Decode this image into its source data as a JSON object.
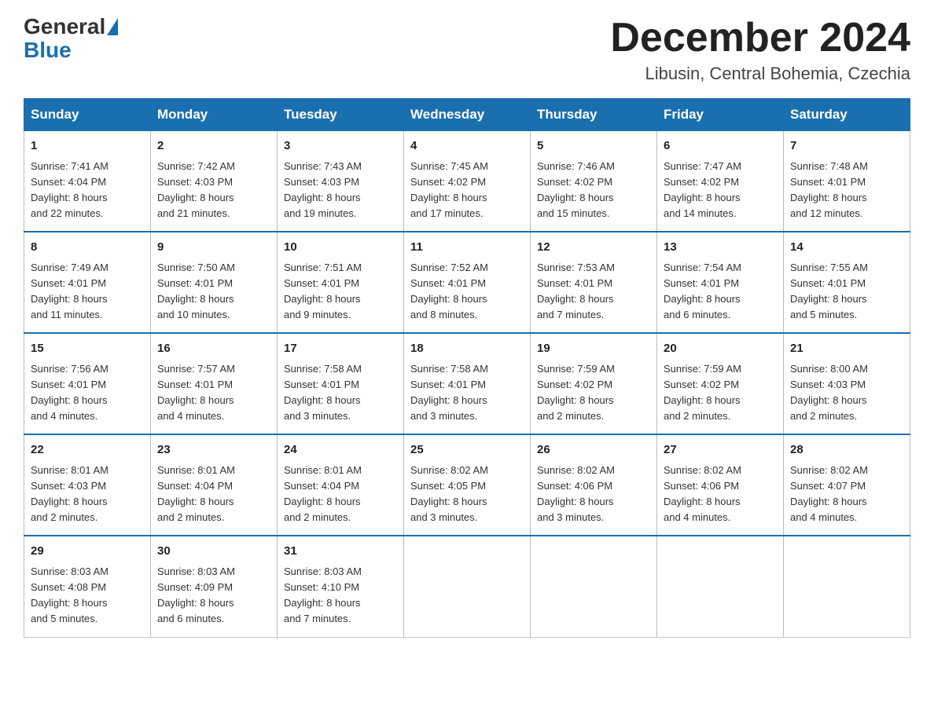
{
  "header": {
    "logo_general": "General",
    "logo_blue": "Blue",
    "title": "December 2024",
    "subtitle": "Libusin, Central Bohemia, Czechia"
  },
  "days_of_week": [
    "Sunday",
    "Monday",
    "Tuesday",
    "Wednesday",
    "Thursday",
    "Friday",
    "Saturday"
  ],
  "weeks": [
    [
      {
        "day": "1",
        "sunrise": "7:41 AM",
        "sunset": "4:04 PM",
        "daylight": "8 hours and 22 minutes."
      },
      {
        "day": "2",
        "sunrise": "7:42 AM",
        "sunset": "4:03 PM",
        "daylight": "8 hours and 21 minutes."
      },
      {
        "day": "3",
        "sunrise": "7:43 AM",
        "sunset": "4:03 PM",
        "daylight": "8 hours and 19 minutes."
      },
      {
        "day": "4",
        "sunrise": "7:45 AM",
        "sunset": "4:02 PM",
        "daylight": "8 hours and 17 minutes."
      },
      {
        "day": "5",
        "sunrise": "7:46 AM",
        "sunset": "4:02 PM",
        "daylight": "8 hours and 15 minutes."
      },
      {
        "day": "6",
        "sunrise": "7:47 AM",
        "sunset": "4:02 PM",
        "daylight": "8 hours and 14 minutes."
      },
      {
        "day": "7",
        "sunrise": "7:48 AM",
        "sunset": "4:01 PM",
        "daylight": "8 hours and 12 minutes."
      }
    ],
    [
      {
        "day": "8",
        "sunrise": "7:49 AM",
        "sunset": "4:01 PM",
        "daylight": "8 hours and 11 minutes."
      },
      {
        "day": "9",
        "sunrise": "7:50 AM",
        "sunset": "4:01 PM",
        "daylight": "8 hours and 10 minutes."
      },
      {
        "day": "10",
        "sunrise": "7:51 AM",
        "sunset": "4:01 PM",
        "daylight": "8 hours and 9 minutes."
      },
      {
        "day": "11",
        "sunrise": "7:52 AM",
        "sunset": "4:01 PM",
        "daylight": "8 hours and 8 minutes."
      },
      {
        "day": "12",
        "sunrise": "7:53 AM",
        "sunset": "4:01 PM",
        "daylight": "8 hours and 7 minutes."
      },
      {
        "day": "13",
        "sunrise": "7:54 AM",
        "sunset": "4:01 PM",
        "daylight": "8 hours and 6 minutes."
      },
      {
        "day": "14",
        "sunrise": "7:55 AM",
        "sunset": "4:01 PM",
        "daylight": "8 hours and 5 minutes."
      }
    ],
    [
      {
        "day": "15",
        "sunrise": "7:56 AM",
        "sunset": "4:01 PM",
        "daylight": "8 hours and 4 minutes."
      },
      {
        "day": "16",
        "sunrise": "7:57 AM",
        "sunset": "4:01 PM",
        "daylight": "8 hours and 4 minutes."
      },
      {
        "day": "17",
        "sunrise": "7:58 AM",
        "sunset": "4:01 PM",
        "daylight": "8 hours and 3 minutes."
      },
      {
        "day": "18",
        "sunrise": "7:58 AM",
        "sunset": "4:01 PM",
        "daylight": "8 hours and 3 minutes."
      },
      {
        "day": "19",
        "sunrise": "7:59 AM",
        "sunset": "4:02 PM",
        "daylight": "8 hours and 2 minutes."
      },
      {
        "day": "20",
        "sunrise": "7:59 AM",
        "sunset": "4:02 PM",
        "daylight": "8 hours and 2 minutes."
      },
      {
        "day": "21",
        "sunrise": "8:00 AM",
        "sunset": "4:03 PM",
        "daylight": "8 hours and 2 minutes."
      }
    ],
    [
      {
        "day": "22",
        "sunrise": "8:01 AM",
        "sunset": "4:03 PM",
        "daylight": "8 hours and 2 minutes."
      },
      {
        "day": "23",
        "sunrise": "8:01 AM",
        "sunset": "4:04 PM",
        "daylight": "8 hours and 2 minutes."
      },
      {
        "day": "24",
        "sunrise": "8:01 AM",
        "sunset": "4:04 PM",
        "daylight": "8 hours and 2 minutes."
      },
      {
        "day": "25",
        "sunrise": "8:02 AM",
        "sunset": "4:05 PM",
        "daylight": "8 hours and 3 minutes."
      },
      {
        "day": "26",
        "sunrise": "8:02 AM",
        "sunset": "4:06 PM",
        "daylight": "8 hours and 3 minutes."
      },
      {
        "day": "27",
        "sunrise": "8:02 AM",
        "sunset": "4:06 PM",
        "daylight": "8 hours and 4 minutes."
      },
      {
        "day": "28",
        "sunrise": "8:02 AM",
        "sunset": "4:07 PM",
        "daylight": "8 hours and 4 minutes."
      }
    ],
    [
      {
        "day": "29",
        "sunrise": "8:03 AM",
        "sunset": "4:08 PM",
        "daylight": "8 hours and 5 minutes."
      },
      {
        "day": "30",
        "sunrise": "8:03 AM",
        "sunset": "4:09 PM",
        "daylight": "8 hours and 6 minutes."
      },
      {
        "day": "31",
        "sunrise": "8:03 AM",
        "sunset": "4:10 PM",
        "daylight": "8 hours and 7 minutes."
      },
      null,
      null,
      null,
      null
    ]
  ],
  "labels": {
    "sunrise": "Sunrise:",
    "sunset": "Sunset:",
    "daylight": "Daylight:"
  }
}
